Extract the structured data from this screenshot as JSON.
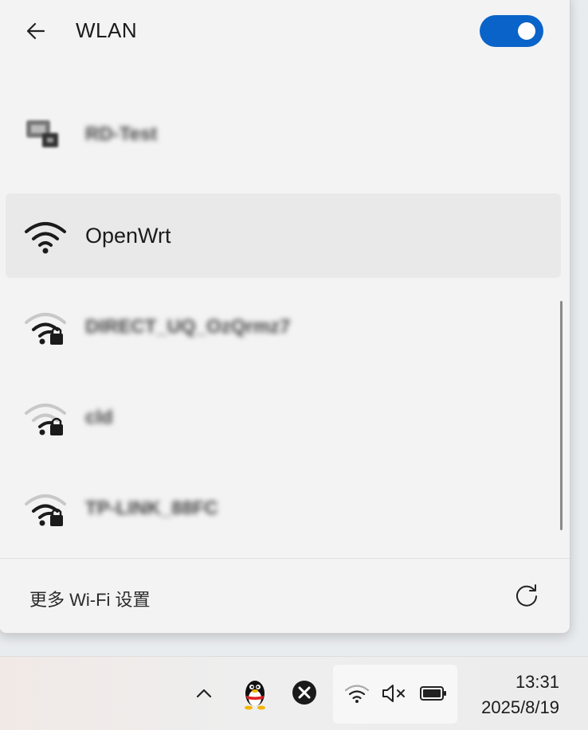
{
  "header": {
    "title": "WLAN",
    "wifi_enabled": true
  },
  "networks": [
    {
      "name": "RD-Test",
      "secured": false,
      "signal": "full",
      "blurred": true,
      "selected": false,
      "icon": "wifi-device-icon"
    },
    {
      "name": "OpenWrt",
      "secured": false,
      "signal": "full",
      "blurred": false,
      "selected": true,
      "icon": "wifi-icon"
    },
    {
      "name": "DIRECT_UQ_OzQrmz7",
      "secured": true,
      "signal": "medium",
      "blurred": true,
      "selected": false,
      "icon": "wifi-lock-icon"
    },
    {
      "name": "cld",
      "secured": true,
      "signal": "low",
      "blurred": true,
      "selected": false,
      "icon": "wifi-lock-icon"
    },
    {
      "name": "TP-LINK_88FC",
      "secured": true,
      "signal": "medium",
      "blurred": true,
      "selected": false,
      "icon": "wifi-lock-icon"
    }
  ],
  "footer": {
    "more_settings": "更多 Wi-Fi 设置"
  },
  "taskbar": {
    "time": "13:31",
    "date": "2025/8/19"
  },
  "colors": {
    "accent": "#0a63c9",
    "panel_bg": "#f3f3f3",
    "selected_bg": "#e9e9e9"
  }
}
